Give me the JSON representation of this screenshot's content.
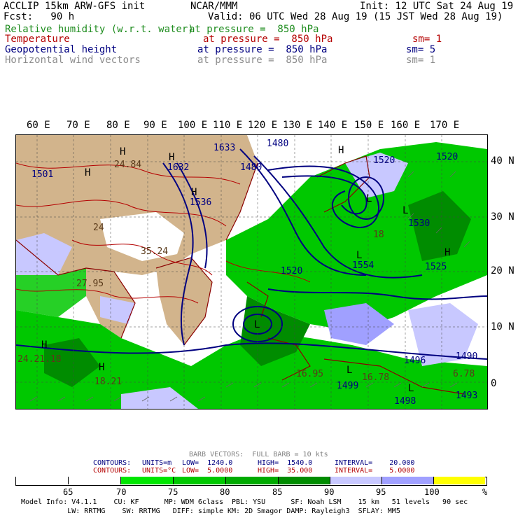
{
  "header": {
    "title": "ACCLIP 15km ARW-GFS init",
    "org": "NCAR/MMM",
    "init": "Init: 12 UTC Sat 24 Aug 19",
    "fcst": "Fcst:   90 h",
    "valid": "Valid: 06 UTC Wed 28 Aug 19 (15 JST Wed 28 Aug 19)",
    "fields": [
      {
        "name": "Relative humidity (w.r.t. water)",
        "level": "at pressure =  850 hPa",
        "sm": "",
        "color": "#1e8c1e"
      },
      {
        "name": "Temperature",
        "level": "at pressure =  850 hPa",
        "sm": "sm= 1",
        "color": "#b40000"
      },
      {
        "name": "Geopotential height",
        "level": "at pressure =  850 hPa",
        "sm": "sm= 5",
        "color": "#000080"
      },
      {
        "name": "Horizontal wind vectors",
        "level": "at pressure =  850 hPa",
        "sm": "sm= 1",
        "color": "#8c8c8c"
      }
    ]
  },
  "map": {
    "lon_labels": [
      "60 E",
      "70 E",
      "80 E",
      "90 E",
      "100 E",
      "110 E",
      "120 E",
      "130 E",
      "140 E",
      "150 E",
      "160 E",
      "170 E"
    ],
    "lat_labels": [
      "40 N",
      "30 N",
      "20 N",
      "10 N",
      "0"
    ],
    "height_labels": [
      "1633",
      "1480",
      "1632",
      "1501",
      "1480",
      "1536",
      "1520",
      "1520",
      "1530",
      "1554",
      "1520",
      "1525",
      "1496",
      "1499",
      "1498",
      "1493",
      "1490"
    ],
    "temp_labels": [
      "24.84",
      "24",
      "35.24",
      "27.95",
      "18.21",
      "24.21.18",
      "16.95",
      "16.78",
      "6.78",
      "18"
    ],
    "pressure_markers": [
      "H",
      "L"
    ],
    "colors": {
      "land": "#d2b48c",
      "ocean": "#ffffff",
      "rh70": "#00c800",
      "rh80": "#008c00",
      "rh95": "#c8c8ff",
      "rh100": "#a0a0ff",
      "geo": "#000080",
      "temp": "#b40000",
      "wind": "#666666"
    }
  },
  "footer": {
    "barb": "BARB VECTORS:  FULL BARB = 10 kts",
    "contours": [
      {
        "label": "CONTOURS:",
        "units": "UNITS=m",
        "low": "LOW=  1240.0",
        "high": "HIGH=  1540.0",
        "interval": "INTERVAL=    20.000",
        "color": "#000080"
      },
      {
        "label": "CONTOURS:",
        "units": "UNITS=°C",
        "low": "LOW=  5.0000",
        "high": "HIGH=  35.000",
        "interval": "INTERVAL=    5.0000",
        "color": "#b40000"
      }
    ],
    "colorbar": {
      "colors": [
        "#ffffff",
        "#ffffff",
        "#00e600",
        "#00c800",
        "#00aa00",
        "#008c00",
        "#c8c8ff",
        "#a0a0ff",
        "#ffff00"
      ],
      "labels": [
        "65",
        "70",
        "75",
        "80",
        "85",
        "90",
        "95",
        "100",
        "%"
      ]
    },
    "model_info_1": "Model Info: V4.1.1    CU: KF      MP: WDM 6class  PBL: YSU      SF: Noah LSM    15 km   51 levels   90 sec",
    "model_info_2": "           LW: RRTMG    SW: RRTMG   DIFF: simple KM: 2D Smagor DAMP: Rayleigh3  SFLAY: MM5"
  }
}
